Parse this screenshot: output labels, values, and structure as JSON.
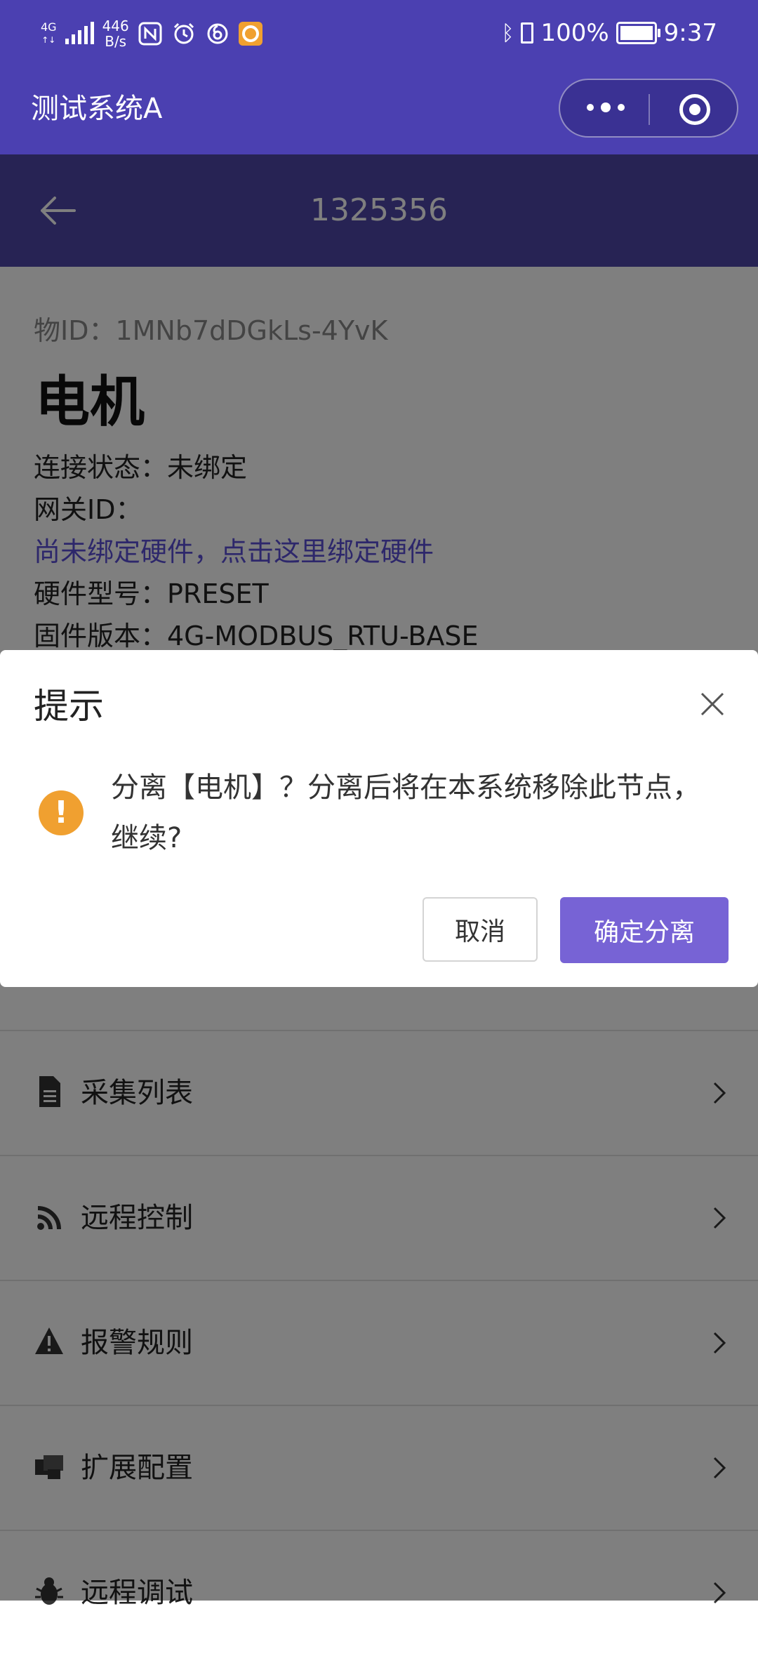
{
  "status_bar": {
    "network_type": "4G",
    "network_speed": "446\nB/s",
    "battery": "100%",
    "time": "9:37"
  },
  "app": {
    "title": "测试系统A"
  },
  "page": {
    "title": "1325356"
  },
  "device": {
    "object_id": "物ID：1MNb7dDGkLs-4YvK",
    "name": "电机",
    "connection_status": "连接状态：未绑定",
    "gateway_id": "网关ID：",
    "bind_link": "尚未绑定硬件，点击这里绑定硬件",
    "hardware_model": "硬件型号：PRESET",
    "firmware_version": "固件版本：4G-MODBUS_RTU-BASE"
  },
  "menu": [
    {
      "label": "采集列表",
      "icon": "document-icon"
    },
    {
      "label": "远程控制",
      "icon": "rss-icon"
    },
    {
      "label": "报警规则",
      "icon": "warning-icon"
    },
    {
      "label": "扩展配置",
      "icon": "config-icon"
    },
    {
      "label": "远程调试",
      "icon": "bug-icon"
    }
  ],
  "dialog": {
    "title": "提示",
    "message": "分离【电机】？分离后将在本系统移除此节点，继续?",
    "cancel_label": "取消",
    "confirm_label": "确定分离"
  },
  "colors": {
    "header": "#4b40b1",
    "page_header": "#4e46a8",
    "accent": "#7763d5",
    "warning": "#f0a030"
  }
}
